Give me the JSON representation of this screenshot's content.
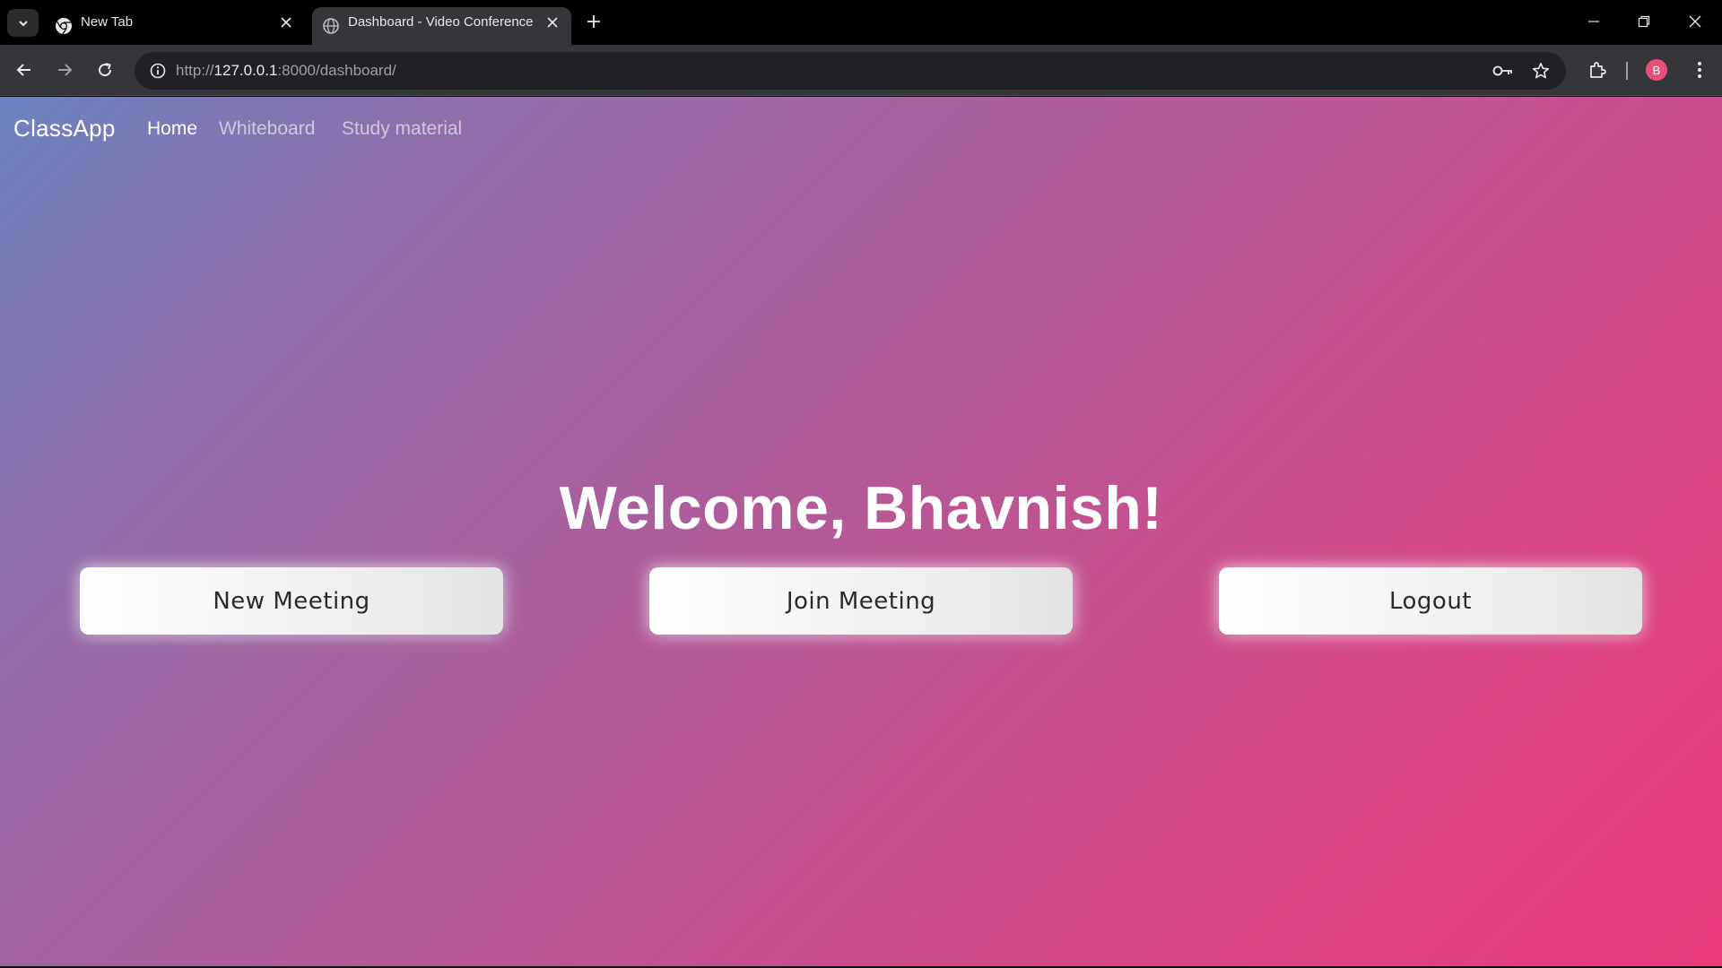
{
  "browser": {
    "tabs": [
      {
        "title": "New Tab",
        "active": false,
        "icon": "chrome-icon"
      },
      {
        "title": "Dashboard - Video Conference",
        "active": true,
        "icon": "globe-icon"
      }
    ],
    "url": {
      "scheme": "http://",
      "host": "127.0.0.1",
      "rest": ":8000/dashboard/"
    },
    "profile_initial": "B",
    "profile_color": "#e94e77"
  },
  "navbar": {
    "brand": "ClassApp",
    "links": [
      {
        "label": "Home",
        "active": true
      },
      {
        "label": "Whiteboard",
        "active": false
      },
      {
        "label": "Study material",
        "active": false
      }
    ]
  },
  "main": {
    "welcome": "Welcome, Bhavnish!",
    "buttons": {
      "new_meeting": "New Meeting",
      "join_meeting": "Join Meeting",
      "logout": "Logout"
    }
  },
  "theme": {
    "gradient_start": "#6b82bf",
    "gradient_mid": "#b05b98",
    "gradient_end": "#ea3a7c"
  }
}
